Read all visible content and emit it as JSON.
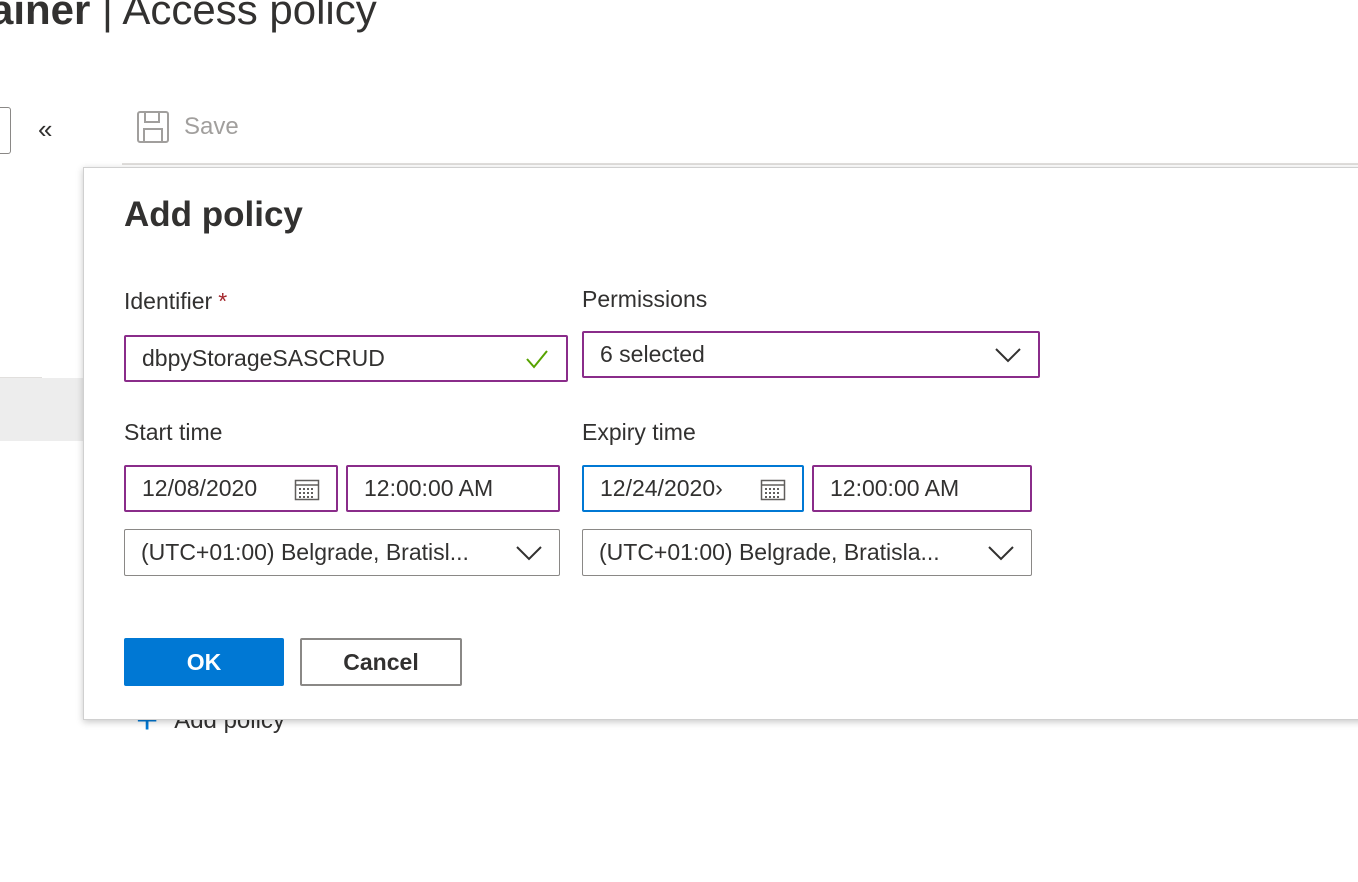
{
  "page": {
    "title_prefix": "ainer",
    "title_separator": " | ",
    "title_main": "Access policy"
  },
  "sidebar": {
    "collapse_glyph": "«"
  },
  "toolbar": {
    "save_label": "Save",
    "save_icon": "save-icon"
  },
  "content": {
    "add_policy_label": "Add policy",
    "add_policy_icon": "plus-icon"
  },
  "dialog": {
    "title": "Add policy",
    "identifier": {
      "label": "Identifier",
      "required_mark": "*",
      "value": "dbpyStorageSASCRUD",
      "valid_icon": "checkmark-icon"
    },
    "permissions": {
      "label": "Permissions",
      "value": "6 selected"
    },
    "start": {
      "label": "Start time",
      "date": "12/08/2020",
      "time": "12:00:00 AM",
      "timezone": "(UTC+01:00) Belgrade, Bratisl..."
    },
    "expiry": {
      "label": "Expiry time",
      "date": "12/24/2020›",
      "time": "12:00:00 AM",
      "timezone": "(UTC+01:00) Belgrade, Bratisla..."
    },
    "ok_label": "OK",
    "cancel_label": "Cancel"
  },
  "colors": {
    "accent": "#0078d4",
    "field_border": "#8a2c8a",
    "valid": "#57a300",
    "required": "#a4262c",
    "disabled_text": "#a19f9d"
  }
}
